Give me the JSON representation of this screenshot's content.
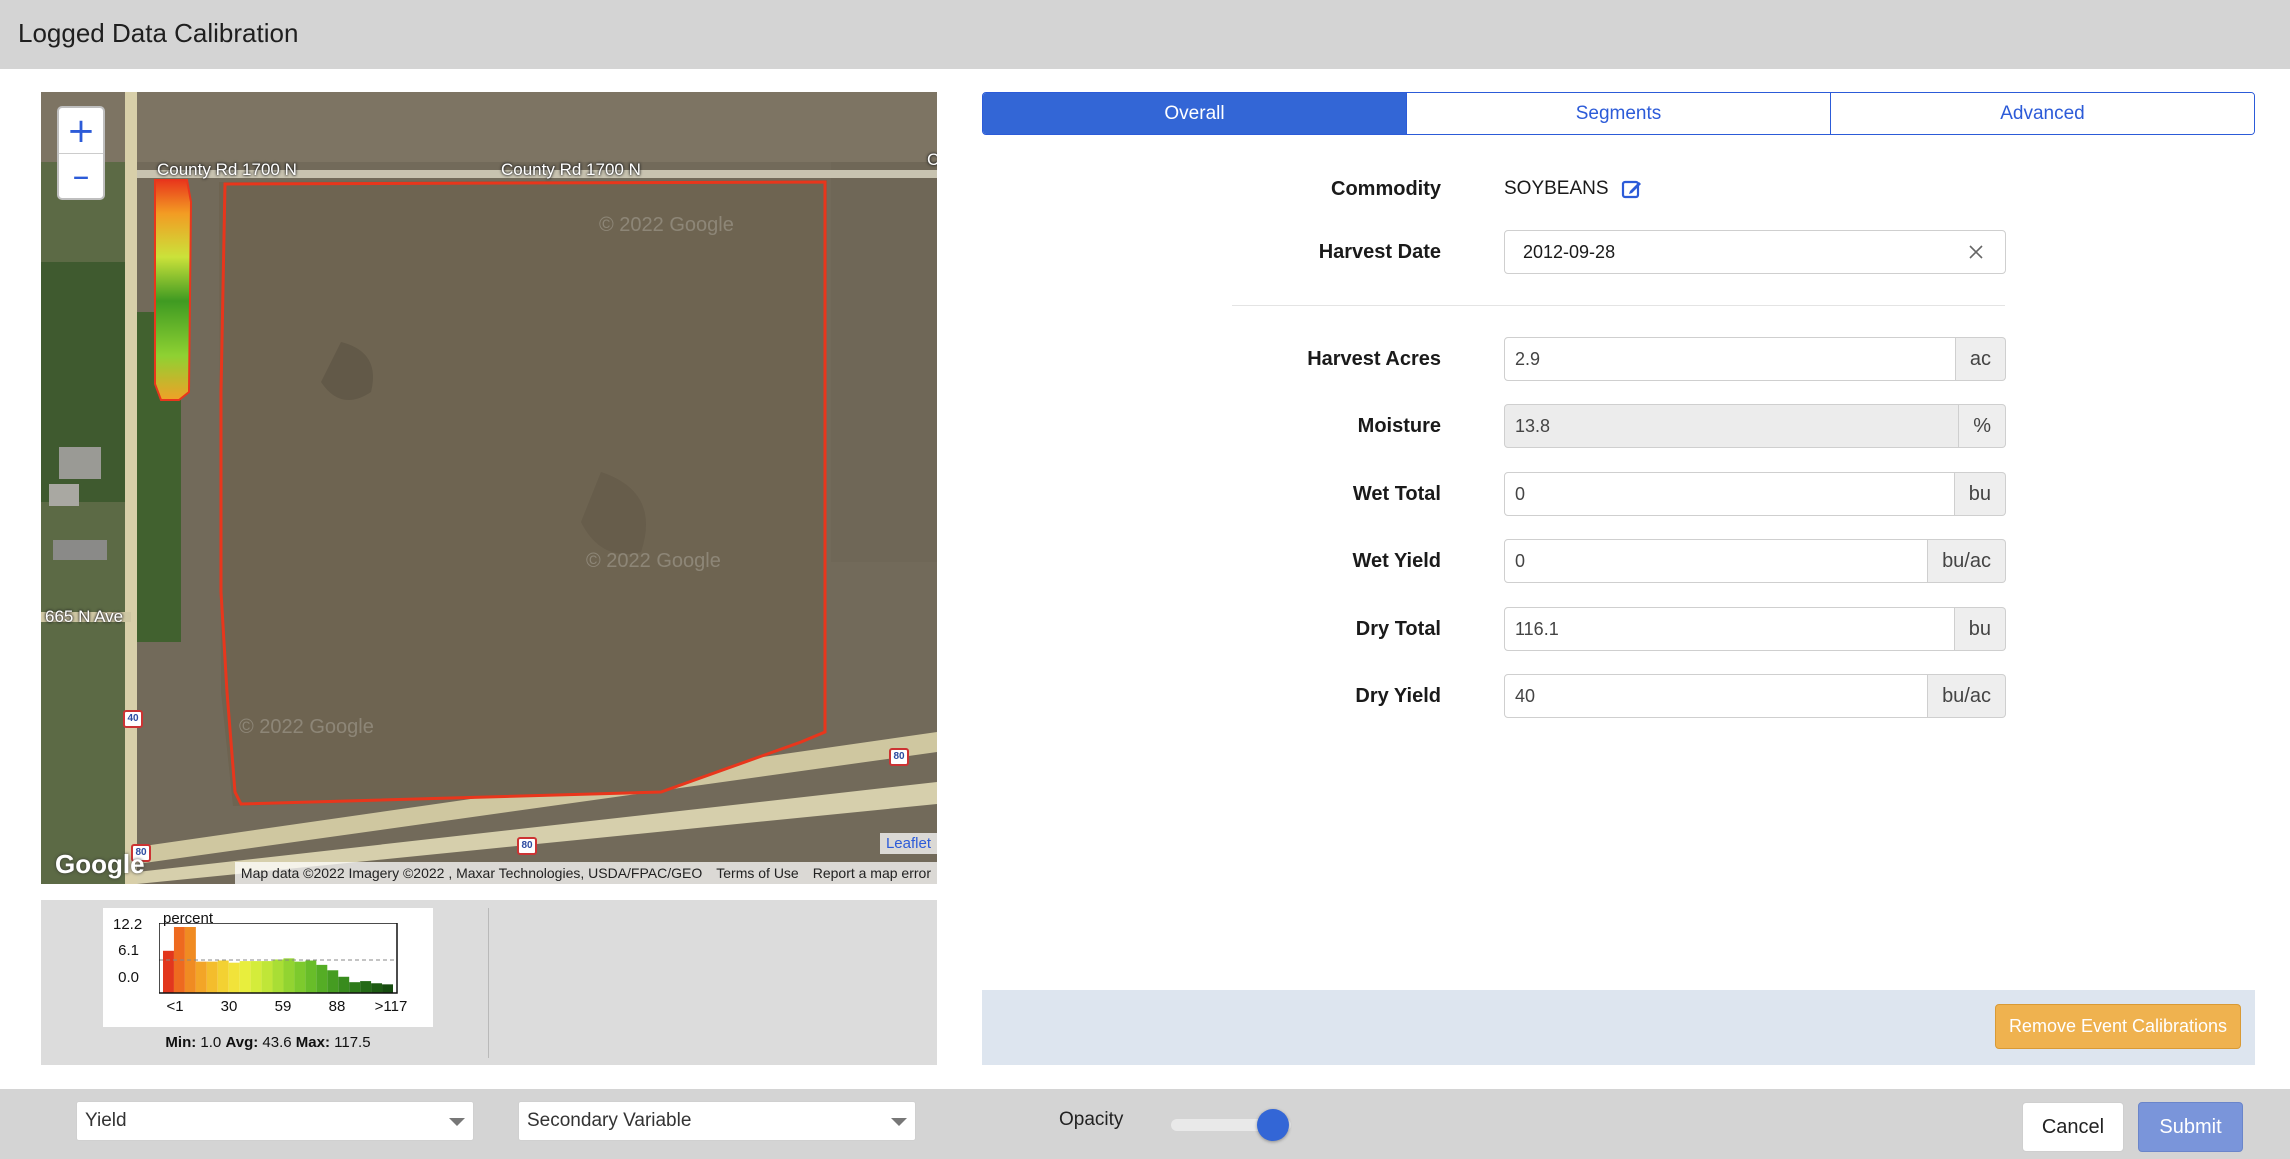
{
  "window": {
    "title": "Logged Data Calibration"
  },
  "map": {
    "zoom_in": "+",
    "zoom_out": "–",
    "road_labels": [
      "County Rd 1700 N",
      "County Rd 1700 N",
      "665 N Ave",
      "C"
    ],
    "route_shields": [
      "40",
      "80",
      "80",
      "80"
    ],
    "watermarks": [
      "© 2022 Google",
      "© 2022 Google",
      "© 2022 Google"
    ],
    "google_logo": "Google",
    "leaflet": "Leaflet",
    "attribution": {
      "map_data": "Map data ©2022 Imagery ©2022 , Maxar Technologies, USDA/FPAC/GEO",
      "terms": "Terms of Use",
      "report": "Report a map error"
    }
  },
  "legend": {
    "unit": "percent",
    "y_ticks": [
      "12.2",
      "6.1",
      "0.0"
    ],
    "x_ticks": [
      "<1",
      "30",
      "59",
      "88",
      ">117"
    ],
    "bins": [
      7.8,
      12.2,
      12.2,
      5.8,
      5.8,
      6.0,
      5.6,
      5.9,
      5.9,
      5.9,
      6.2,
      6.4,
      5.8,
      6.0,
      5.2,
      4.2,
      3.0,
      2.0,
      2.2,
      1.8,
      1.6
    ],
    "bin_colors": [
      "#e2371d",
      "#ee6a1f",
      "#f08b22",
      "#f3a527",
      "#f4bd2c",
      "#f3d132",
      "#f1e33a",
      "#e8ee3d",
      "#d4ec3b",
      "#c0e638",
      "#a9de35",
      "#92d431",
      "#7dca2d",
      "#68bd29",
      "#55ad25",
      "#459c21",
      "#388b1d",
      "#2d7a19",
      "#246a16",
      "#1d5a12",
      "#164b0f"
    ],
    "stats": {
      "min_label": "Min:",
      "min": "1.0",
      "avg_label": "Avg:",
      "avg": "43.6",
      "max_label": "Max:",
      "max": "117.5"
    }
  },
  "tabs": [
    {
      "label": "Overall",
      "active": true
    },
    {
      "label": "Segments",
      "active": false
    },
    {
      "label": "Advanced",
      "active": false
    }
  ],
  "form": {
    "commodity": {
      "label": "Commodity",
      "value": "SOYBEANS"
    },
    "harvest_date": {
      "label": "Harvest Date",
      "value": "2012-09-28"
    },
    "harvest_acres": {
      "label": "Harvest Acres",
      "value": "2.9",
      "unit": "ac"
    },
    "moisture": {
      "label": "Moisture",
      "value": "13.8",
      "unit": "%"
    },
    "wet_total": {
      "label": "Wet Total",
      "value": "0",
      "unit": "bu"
    },
    "wet_yield": {
      "label": "Wet Yield",
      "value": "0",
      "unit": "bu/ac"
    },
    "dry_total": {
      "label": "Dry Total",
      "value": "116.1",
      "unit": "bu"
    },
    "dry_yield": {
      "label": "Dry Yield",
      "value": "40",
      "unit": "bu/ac"
    }
  },
  "actions": {
    "remove_label": "Remove Event Calibrations"
  },
  "bottom": {
    "primary_select": "Yield",
    "secondary_select": "Secondary Variable",
    "opacity_label": "Opacity",
    "opacity_value": 0.85,
    "cancel_label": "Cancel",
    "submit_label": "Submit"
  },
  "colors": {
    "accent": "#3366d6",
    "field_boundary": "#e8361c",
    "remove_button": "#efb24f",
    "submit_button": "#7a95da"
  }
}
